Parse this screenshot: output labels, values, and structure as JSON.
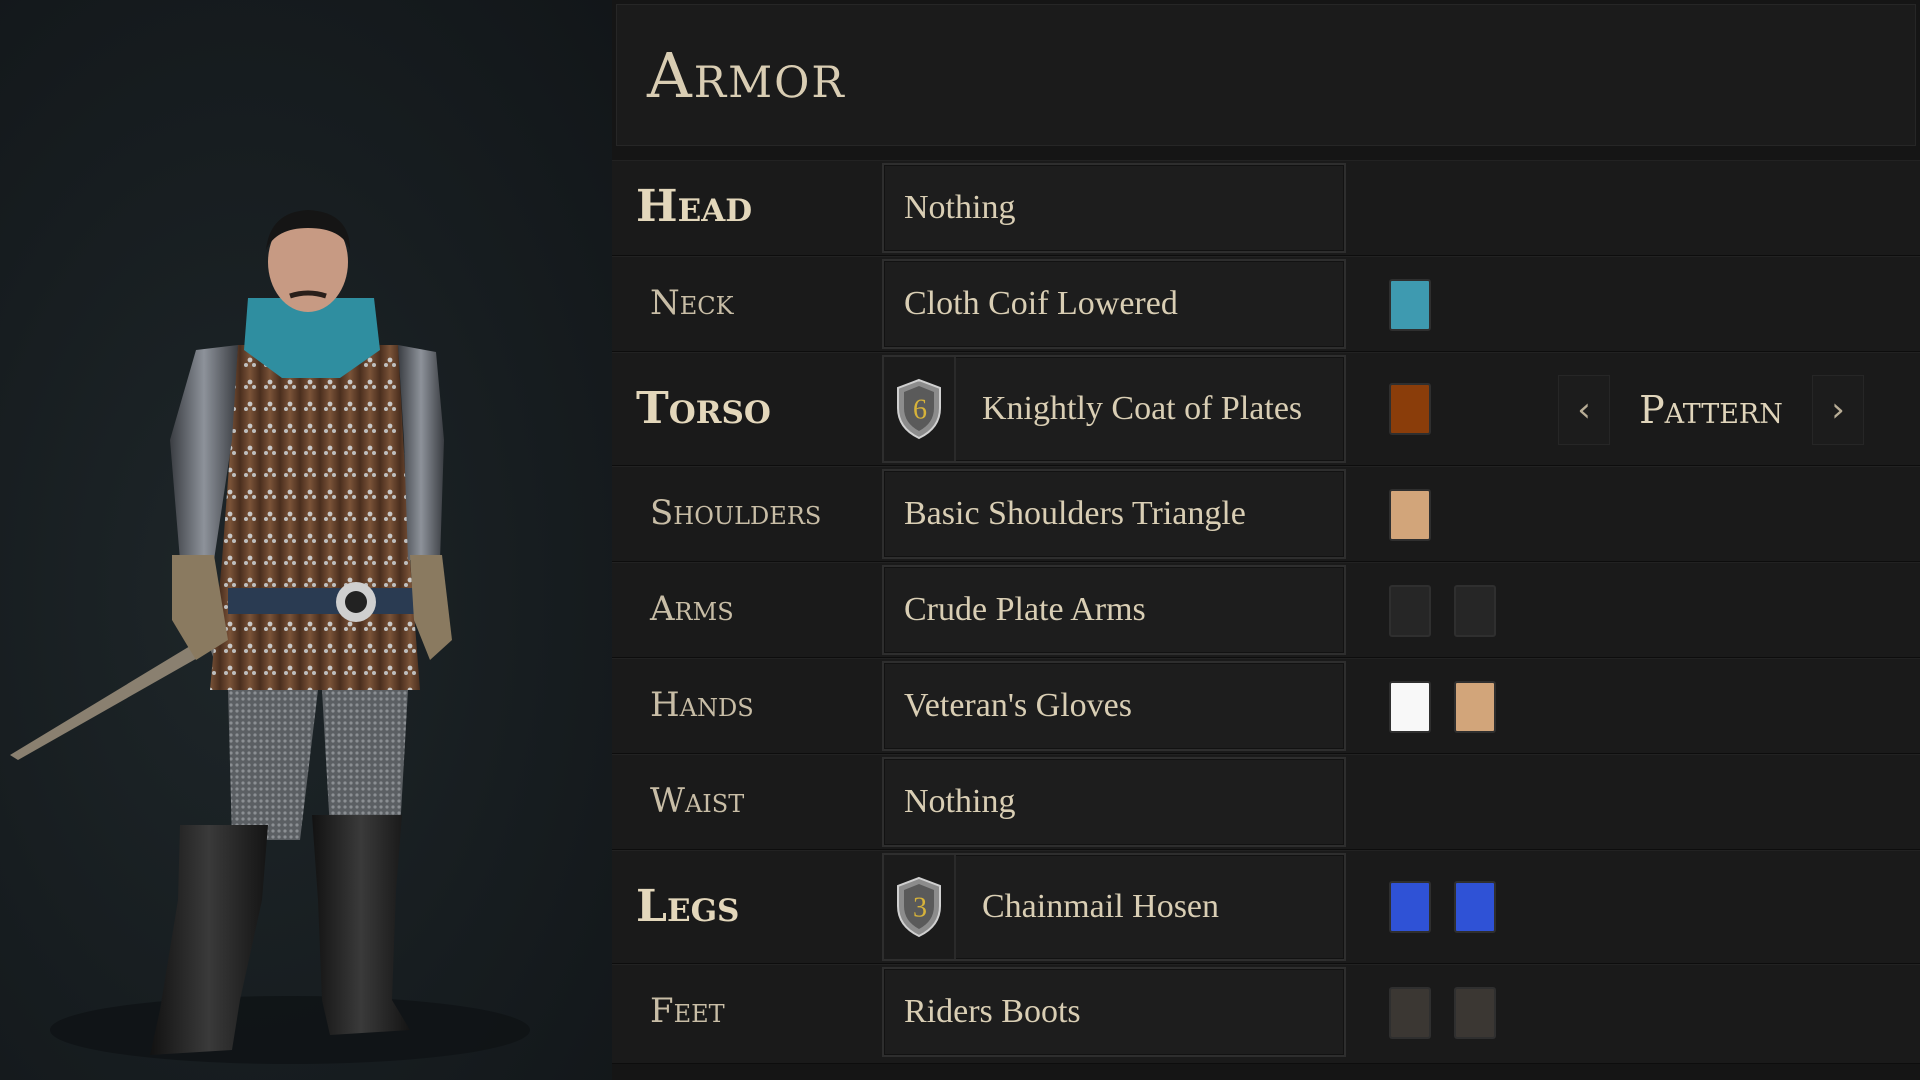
{
  "panel": {
    "title": "Armor"
  },
  "slots": [
    {
      "label": "Head",
      "major": true,
      "item": "Nothing",
      "swatches": []
    },
    {
      "label": "Neck",
      "major": false,
      "item": "Cloth Coif Lowered",
      "swatches": [
        "#3e9ab0"
      ]
    },
    {
      "label": "Torso",
      "major": true,
      "item": "Knightly Coat of Plates",
      "badge": "6",
      "swatches": [
        "#8a3d0a"
      ],
      "pattern": {
        "label": "Pattern",
        "prev": "‹",
        "next": "›"
      }
    },
    {
      "label": "Shoulders",
      "major": false,
      "item": "Basic Shoulders Triangle",
      "swatches": [
        "#d2a57a"
      ]
    },
    {
      "label": "Arms",
      "major": false,
      "item": "Crude Plate Arms",
      "swatches": [
        "#262626",
        "#262626"
      ]
    },
    {
      "label": "Hands",
      "major": false,
      "item": "Veteran's Gloves",
      "swatches": [
        "#f8f8f8",
        "#d2a57a"
      ]
    },
    {
      "label": "Waist",
      "major": false,
      "item": "Nothing",
      "swatches": []
    },
    {
      "label": "Legs",
      "major": true,
      "item": "Chainmail Hosen",
      "badge": "3",
      "swatches": [
        "#2f52d6",
        "#2f52d6"
      ]
    },
    {
      "label": "Feet",
      "major": false,
      "item": "Riders Boots",
      "swatches": [
        "#3b3733",
        "#3b3733"
      ]
    }
  ]
}
